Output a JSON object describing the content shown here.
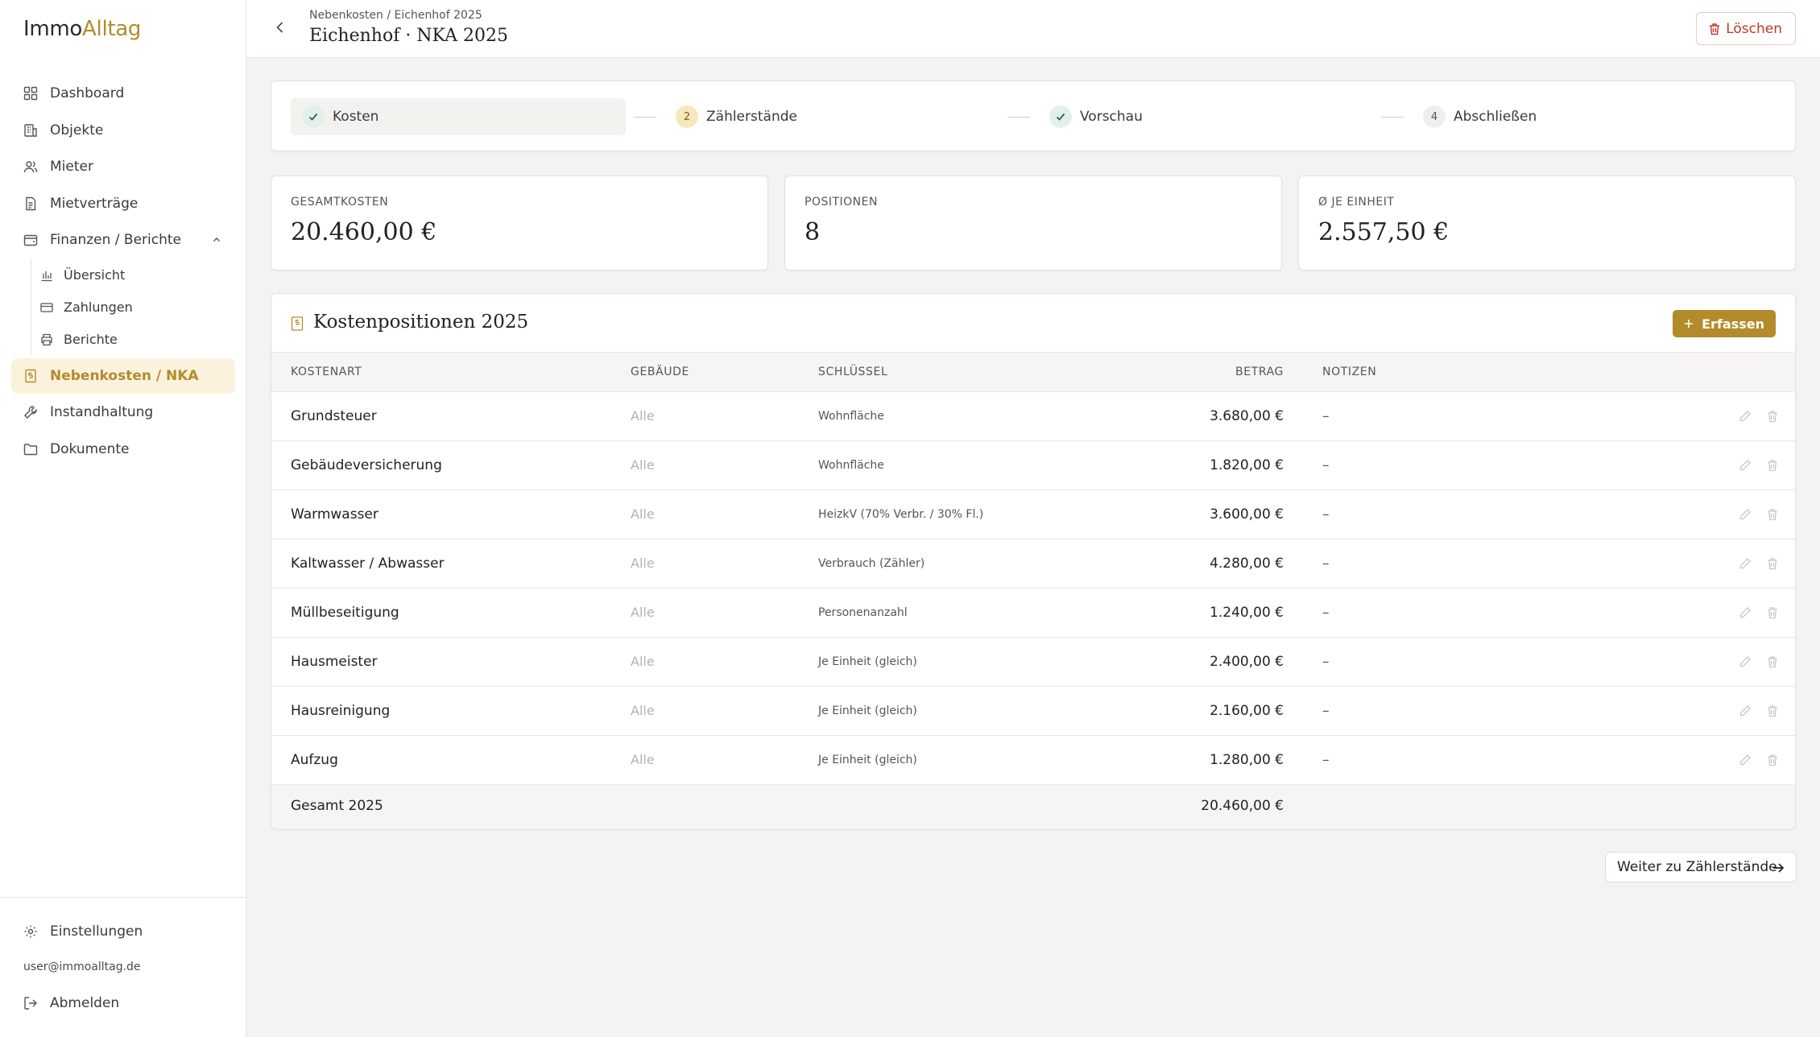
{
  "app": {
    "logo_part1": "Immo",
    "logo_part2": "Alltag",
    "accent_color": "#b38b2a"
  },
  "sidebar": {
    "items": [
      {
        "label": "Dashboard",
        "icon": "grid-icon"
      },
      {
        "label": "Objekte",
        "icon": "building-icon"
      },
      {
        "label": "Mieter",
        "icon": "users-icon"
      },
      {
        "label": "Mietverträge",
        "icon": "document-icon"
      },
      {
        "label": "Finanzen / Berichte",
        "icon": "wallet-icon"
      }
    ],
    "sub_items": [
      {
        "label": "Übersicht",
        "icon": "bar-chart-icon"
      },
      {
        "label": "Zahlungen",
        "icon": "credit-card-icon"
      },
      {
        "label": "Berichte",
        "icon": "printer-icon"
      }
    ],
    "items_after": [
      {
        "label": "Nebenkosten / NKA",
        "icon": "receipt-icon",
        "active": true
      },
      {
        "label": "Instandhaltung",
        "icon": "wrench-icon"
      },
      {
        "label": "Dokumente",
        "icon": "folder-icon"
      }
    ],
    "settings_label": "Einstellungen",
    "user_email": "user@immoalltag.de",
    "logout_label": "Abmelden"
  },
  "header": {
    "breadcrumb": "Nebenkosten / Eichenhof 2025",
    "title": "Eichenhof · NKA 2025",
    "delete_label": "Löschen"
  },
  "stepper": {
    "steps": [
      {
        "label": "Kosten",
        "badge": "✓",
        "state": "done"
      },
      {
        "label": "Zählerstände",
        "badge": "2",
        "state": "current"
      },
      {
        "label": "Vorschau",
        "badge": "✓",
        "state": "done"
      },
      {
        "label": "Abschließen",
        "badge": "4",
        "state": "todo"
      }
    ]
  },
  "stats": [
    {
      "label": "GESAMTKOSTEN",
      "value": "20.460,00 €"
    },
    {
      "label": "POSITIONEN",
      "value": "8"
    },
    {
      "label": "Ø JE EINHEIT",
      "value": "2.557,50 €"
    }
  ],
  "cost_table": {
    "title": "Kostenpositionen 2025",
    "add_label": "Erfassen",
    "columns": [
      "KOSTENART",
      "GEBÄUDE",
      "SCHLÜSSEL",
      "BETRAG",
      "NOTIZEN"
    ],
    "rows": [
      {
        "kostenart": "Grundsteuer",
        "gebaeude": "Alle",
        "schluessel": "Wohnfläche",
        "betrag": "3.680,00 €",
        "notizen": "–"
      },
      {
        "kostenart": "Gebäudeversicherung",
        "gebaeude": "Alle",
        "schluessel": "Wohnfläche",
        "betrag": "1.820,00 €",
        "notizen": "–"
      },
      {
        "kostenart": "Warmwasser",
        "gebaeude": "Alle",
        "schluessel": "HeizkV (70% Verbr. / 30% Fl.)",
        "betrag": "3.600,00 €",
        "notizen": "–"
      },
      {
        "kostenart": "Kaltwasser / Abwasser",
        "gebaeude": "Alle",
        "schluessel": "Verbrauch (Zähler)",
        "betrag": "4.280,00 €",
        "notizen": "–"
      },
      {
        "kostenart": "Müllbeseitigung",
        "gebaeude": "Alle",
        "schluessel": "Personenanzahl",
        "betrag": "1.240,00 €",
        "notizen": "–"
      },
      {
        "kostenart": "Hausmeister",
        "gebaeude": "Alle",
        "schluessel": "Je Einheit (gleich)",
        "betrag": "2.400,00 €",
        "notizen": "–"
      },
      {
        "kostenart": "Hausreinigung",
        "gebaeude": "Alle",
        "schluessel": "Je Einheit (gleich)",
        "betrag": "2.160,00 €",
        "notizen": "–"
      },
      {
        "kostenart": "Aufzug",
        "gebaeude": "Alle",
        "schluessel": "Je Einheit (gleich)",
        "betrag": "1.280,00 €",
        "notizen": "–"
      }
    ],
    "total_label": "Gesamt 2025",
    "total_value": "20.460,00 €"
  },
  "next_button_label": "Weiter zu Zählerstände"
}
